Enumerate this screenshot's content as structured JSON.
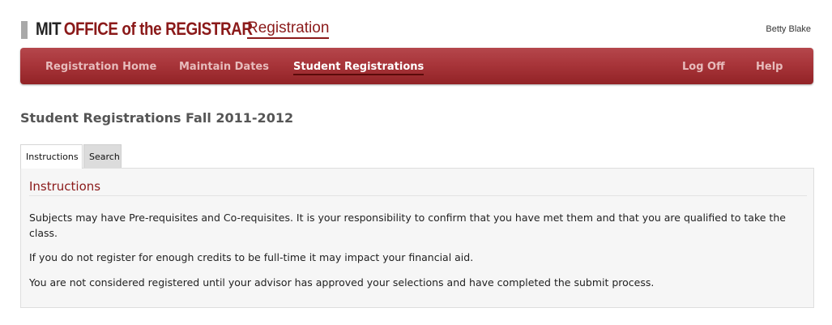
{
  "header": {
    "logo_mit": "MIT",
    "logo_office": "OFFICE of the REGISTRAR",
    "app_title": "Registration",
    "user_name": "Betty Blake"
  },
  "nav": {
    "items": [
      {
        "label": "Registration Home"
      },
      {
        "label": "Maintain Dates"
      },
      {
        "label": "Student Registrations"
      },
      {
        "label": "Log Off"
      },
      {
        "label": "Help"
      }
    ],
    "active_item": "Student Registrations"
  },
  "page": {
    "title": "Student Registrations Fall 2011-2012"
  },
  "tabs": [
    {
      "label": "Instructions"
    },
    {
      "label": "Search"
    }
  ],
  "active_tab": "Instructions",
  "panel": {
    "heading": "Instructions",
    "paragraphs": [
      "Subjects may have Pre-requisites and Co-requisites. It is your responsibility to confirm that you have met them and that you are qualified to take the class.",
      "If you do not register for enough credits to be full-time it may impact your financial aid.",
      "You are not considered registered until your advisor has approved your selections and have completed the submit process."
    ]
  },
  "colors": {
    "brand": "#8b1a1a",
    "nav_bg": "#a8353a",
    "nav_text": "#e7bcbc",
    "nav_active_text": "#ffffff"
  }
}
